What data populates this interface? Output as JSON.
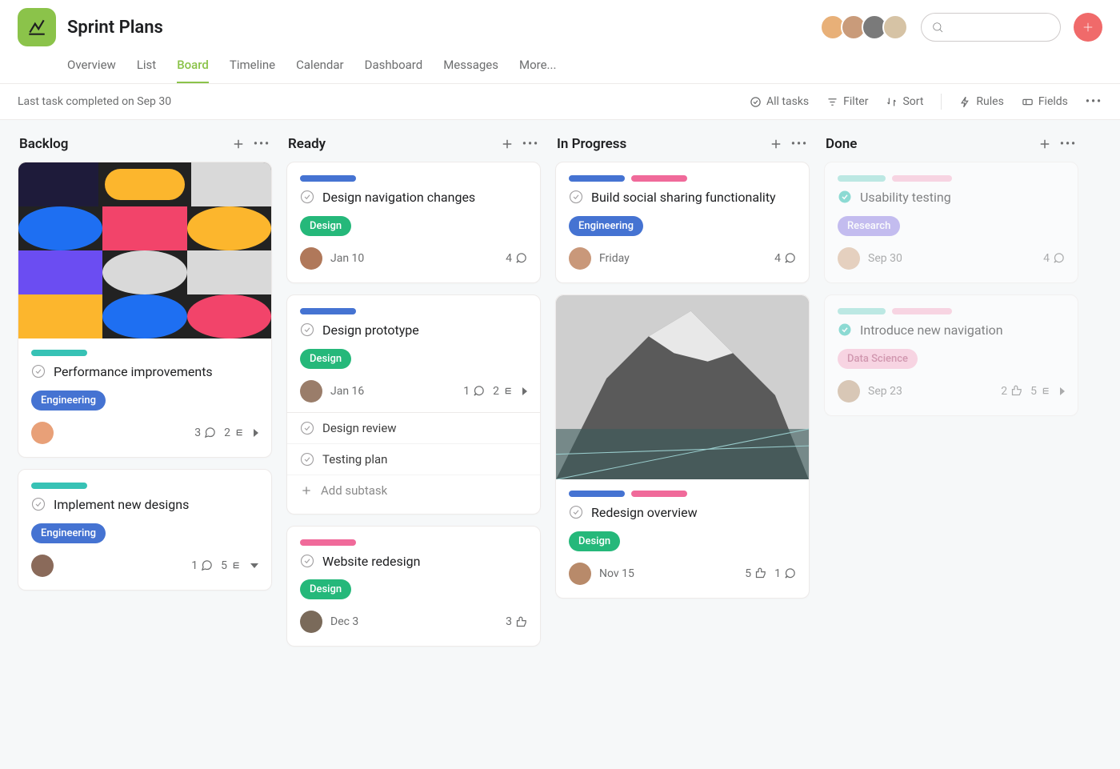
{
  "project": {
    "title": "Sprint Plans"
  },
  "tabs": {
    "overview": "Overview",
    "list": "List",
    "board": "Board",
    "timeline": "Timeline",
    "calendar": "Calendar",
    "dashboard": "Dashboard",
    "messages": "Messages",
    "more": "More..."
  },
  "toolbar": {
    "last_completed": "Last task completed on Sep 30",
    "all_tasks": "All tasks",
    "filter": "Filter",
    "sort": "Sort",
    "rules": "Rules",
    "fields": "Fields"
  },
  "columns": {
    "backlog": {
      "title": "Backlog",
      "cards": [
        {
          "title": "Performance improvements",
          "tag": "Engineering",
          "comments": "3",
          "subtasks": "2"
        },
        {
          "title": "Implement new designs",
          "tag": "Engineering",
          "comments": "1",
          "subtasks": "5"
        }
      ]
    },
    "ready": {
      "title": "Ready",
      "cards": [
        {
          "title": "Design navigation changes",
          "tag": "Design",
          "due": "Jan 10",
          "comments": "4"
        },
        {
          "title": "Design prototype",
          "tag": "Design",
          "due": "Jan 16",
          "comments": "1",
          "subtasks": "2",
          "children": [
            "Design review",
            "Testing plan"
          ],
          "add_subtask": "Add subtask"
        },
        {
          "title": "Website redesign",
          "tag": "Design",
          "due": "Dec 3",
          "likes": "3"
        }
      ]
    },
    "inprogress": {
      "title": "In Progress",
      "cards": [
        {
          "title": "Build social sharing functionality",
          "tag": "Engineering",
          "due": "Friday",
          "comments": "4"
        },
        {
          "title": "Redesign overview",
          "tag": "Design",
          "due": "Nov 15",
          "likes": "5",
          "comments": "1"
        }
      ]
    },
    "done": {
      "title": "Done",
      "cards": [
        {
          "title": "Usability testing",
          "tag": "Research",
          "due": "Sep 30",
          "comments": "4"
        },
        {
          "title": "Introduce new navigation",
          "tag": "Data Science",
          "due": "Sep 23",
          "likes": "2",
          "subtasks": "5"
        }
      ]
    }
  }
}
